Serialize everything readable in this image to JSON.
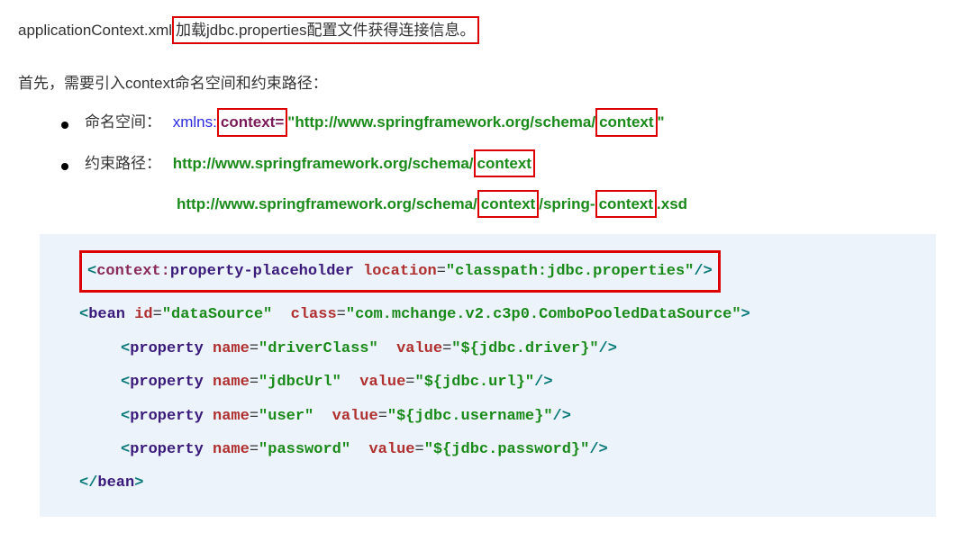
{
  "intro": {
    "prefix": "applicationContext.xml",
    "boxed": "加载jdbc.properties配置文件获得连接信息。"
  },
  "lead": "首先，需要引入context命名空间和约束路径：",
  "bullets": {
    "ns": {
      "label": "命名空间：",
      "xmlns_pre": "xmlns:",
      "xmlns_box": "context=",
      "quote1": "\"",
      "url_pre": "http://www.springframework.org/schema/",
      "url_box": "context",
      "quote2": "\""
    },
    "path": {
      "label": "约束路径：",
      "url1_pre": "http://www.springframework.org/schema/",
      "url1_box": "context",
      "url2_pre": "http://www.springframework.org/schema/",
      "url2_box1": "context",
      "url2_mid": "/spring-",
      "url2_box2": "context",
      "url2_end": ".xsd"
    }
  },
  "code": {
    "line1": {
      "lt": "<",
      "ns": "context",
      "colon": ":",
      "elem": "property-placeholder",
      "attr": "location",
      "eq": "=",
      "val": "\"classpath:jdbc.properties\"",
      "end": "/>"
    },
    "line2": {
      "lt": "<",
      "elem": "bean",
      "attr1": "id",
      "val1": "\"dataSource\"",
      "attr2": "class",
      "val2": "\"com.mchange.v2.c3p0.ComboPooledDataSource\"",
      "gt": ">"
    },
    "props": [
      {
        "name": "\"driverClass\"",
        "value": "\"${jdbc.driver}\""
      },
      {
        "name": "\"jdbcUrl\"",
        "value": "\"${jdbc.url}\""
      },
      {
        "name": "\"user\"",
        "value": "\"${jdbc.username}\""
      },
      {
        "name": "\"password\"",
        "value": "\"${jdbc.password}\""
      }
    ],
    "prop_elem": "property",
    "prop_name_attr": "name",
    "prop_value_attr": "value",
    "prop_end": "/>",
    "close": {
      "lt": "</",
      "elem": "bean",
      "gt": ">"
    }
  }
}
